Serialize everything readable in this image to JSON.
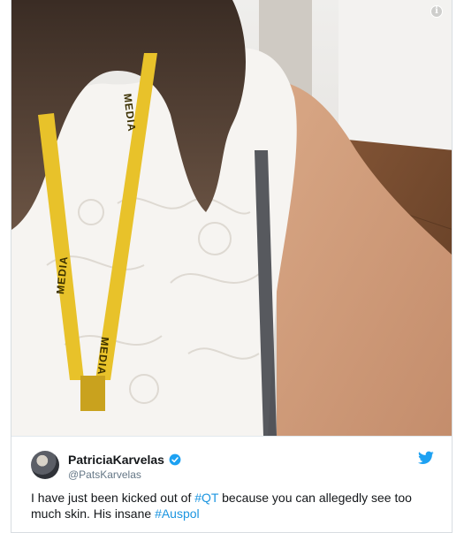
{
  "tweet": {
    "display_name": "PatriciaKarvelas",
    "handle": "@PatsKarvelas",
    "text_part1": "I have just been kicked out of ",
    "hashtag1": "#QT",
    "text_part2": " because you can allegedly see too much skin. His insane ",
    "hashtag2": "#Auspol"
  },
  "photo": {
    "lanyard_text": [
      "MEDIA",
      "MEDIA",
      "MEDIA"
    ]
  },
  "colors": {
    "link": "#1b95e0",
    "lanyard": "#e8c22a"
  },
  "icons": {
    "info": "info-icon",
    "verified": "verified-badge-icon",
    "brand": "twitter-bird-icon"
  }
}
